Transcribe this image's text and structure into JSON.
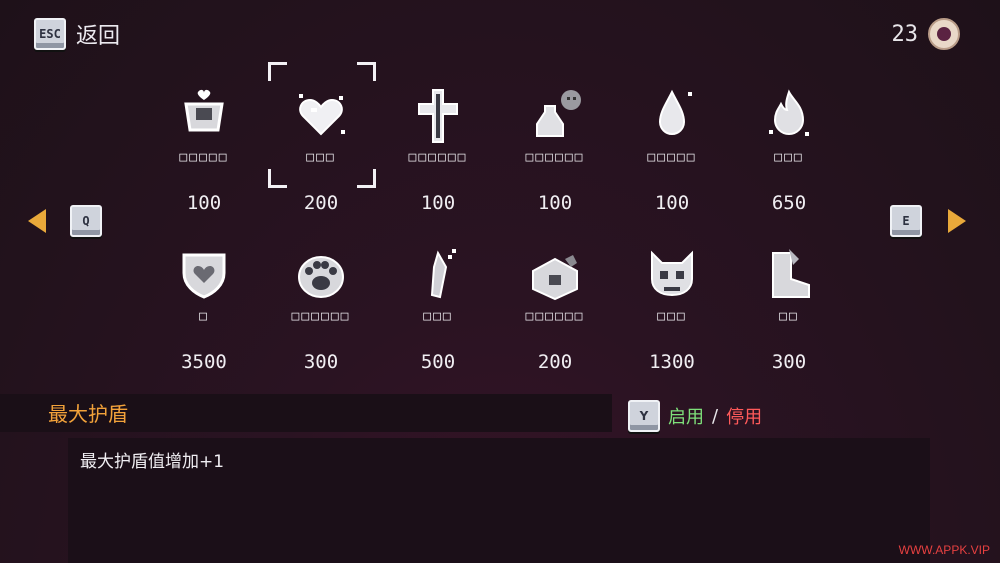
{
  "header": {
    "back_key": "ESC",
    "back_label": "返回",
    "currency_value": "23",
    "currency_icon": "eye-icon"
  },
  "nav": {
    "prev_key": "Q",
    "next_key": "E"
  },
  "items": [
    {
      "id": "armor",
      "icon": "chestplate-heart-icon",
      "name": "□□□□□",
      "price": "100"
    },
    {
      "id": "heart",
      "icon": "heart-icon",
      "name": "□□□",
      "price": "200"
    },
    {
      "id": "cross",
      "icon": "cross-icon",
      "name": "□□□□□□",
      "price": "100"
    },
    {
      "id": "potion",
      "icon": "potion-skull-icon",
      "name": "□□□□□□",
      "price": "100"
    },
    {
      "id": "drop",
      "icon": "water-drop-icon",
      "name": "□□□□□",
      "price": "100"
    },
    {
      "id": "flame",
      "icon": "flame-icon",
      "name": "□□□",
      "price": "650"
    },
    {
      "id": "shield",
      "icon": "shield-heart-icon",
      "name": "□",
      "price": "3500"
    },
    {
      "id": "paw",
      "icon": "paw-icon",
      "name": "□□□□□□",
      "price": "300"
    },
    {
      "id": "crystal",
      "icon": "crystal-icon",
      "name": "□□□",
      "price": "500"
    },
    {
      "id": "box",
      "icon": "box-icon",
      "name": "□□□□□□",
      "price": "200"
    },
    {
      "id": "cat-skull",
      "icon": "cat-skull-icon",
      "name": "□□□",
      "price": "1300"
    },
    {
      "id": "boot",
      "icon": "boot-icon",
      "name": "□□",
      "price": "300"
    }
  ],
  "selected": {
    "title": "最大护盾",
    "toggle_key": "Y",
    "enable_label": "启用",
    "separator": "/",
    "disable_label": "停用",
    "description": "最大护盾值增加+1"
  },
  "watermark": "WWW.APPK.VIP"
}
